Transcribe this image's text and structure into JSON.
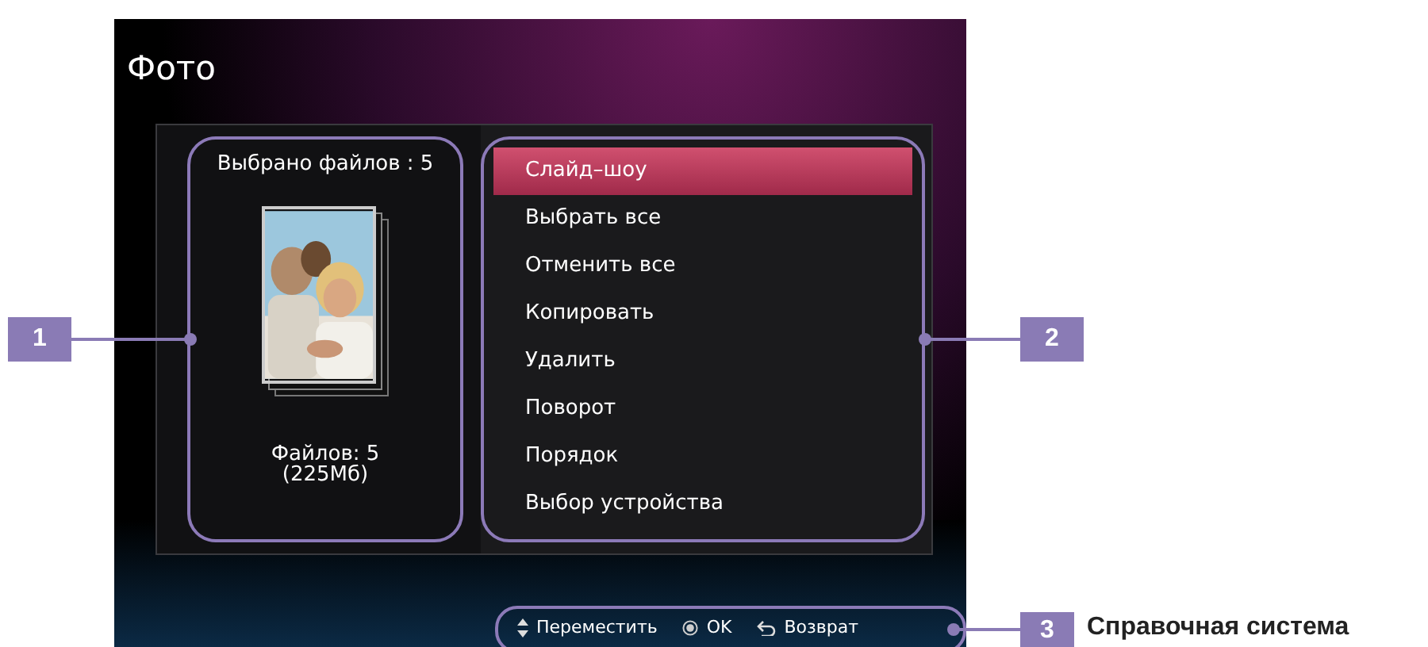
{
  "screen": {
    "title": "Фото",
    "selection": {
      "label": "Выбрано файлов : 5",
      "thumbnail": {
        "kind": "picture"
      },
      "summary": [
        "Файлов: 5",
        "(225Мб)"
      ]
    },
    "menu": [
      {
        "label": "Слайд–шоу",
        "selected": true
      },
      {
        "label": "Выбрать все",
        "selected": false
      },
      {
        "label": "Отменить все",
        "selected": false
      },
      {
        "label": "Копировать",
        "selected": false
      },
      {
        "label": "Удалить",
        "selected": false
      },
      {
        "label": "Поворот",
        "selected": false
      },
      {
        "label": "Порядок",
        "selected": false
      },
      {
        "label": "Выбор устройства",
        "selected": false
      }
    ],
    "hints": [
      {
        "kind": "move",
        "label": "Переместить"
      },
      {
        "kind": "ok",
        "label": "OK"
      },
      {
        "kind": "back",
        "label": "Возврат"
      }
    ]
  },
  "callouts": [
    {
      "number": "1"
    },
    {
      "number": "2"
    },
    {
      "number": "3",
      "label": "Справочная система"
    }
  ]
}
